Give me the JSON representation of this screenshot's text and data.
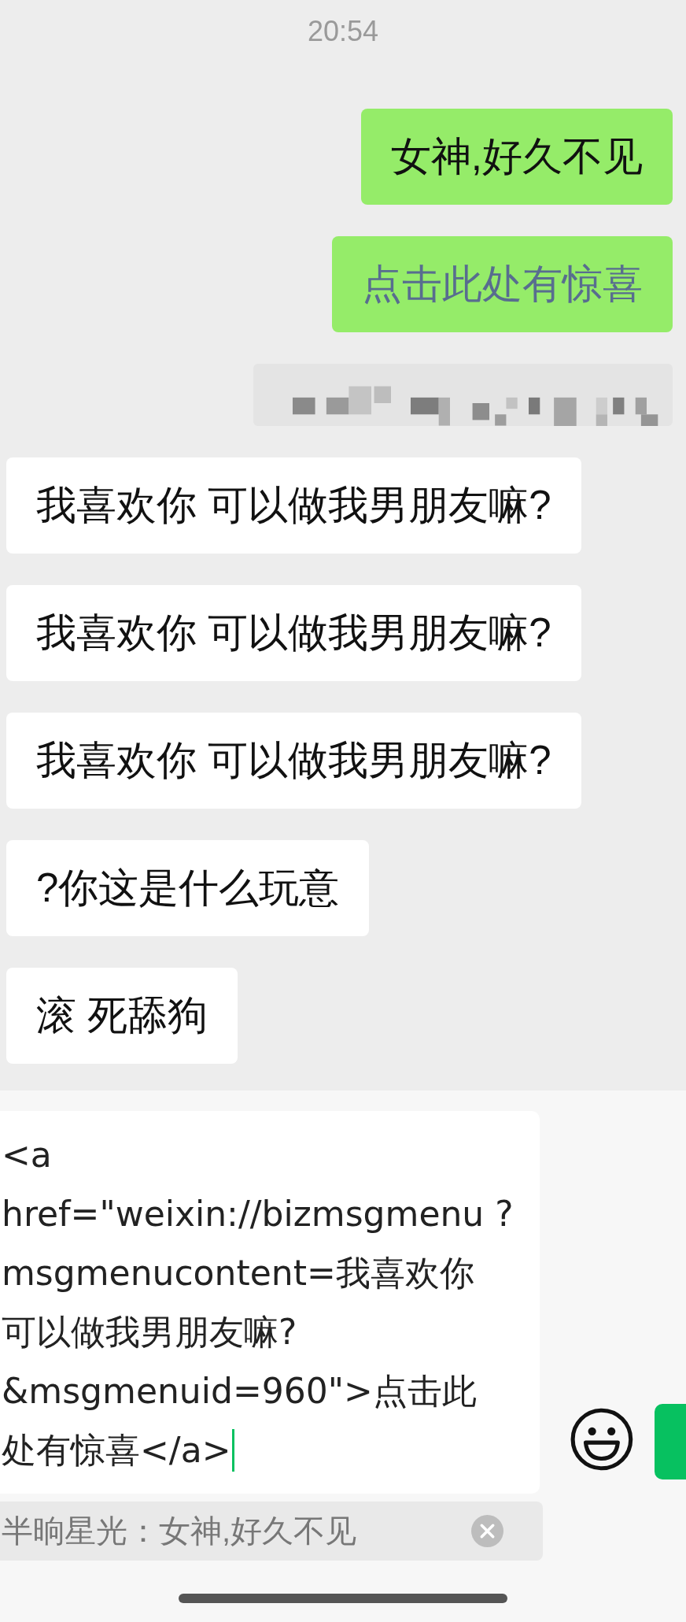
{
  "time": "20:54",
  "messages": [
    {
      "outgoing": true,
      "kind": "text",
      "text": "女神,好久不见"
    },
    {
      "outgoing": true,
      "kind": "link",
      "text": "点击此处有惊喜"
    },
    {
      "outgoing": true,
      "kind": "obscured"
    },
    {
      "outgoing": false,
      "kind": "text",
      "text": "我喜欢你 可以做我男朋友嘛?"
    },
    {
      "outgoing": false,
      "kind": "text",
      "text": "我喜欢你 可以做我男朋友嘛?"
    },
    {
      "outgoing": false,
      "kind": "text",
      "text": "我喜欢你 可以做我男朋友嘛?"
    },
    {
      "outgoing": false,
      "kind": "text",
      "text": "?你这是什么玩意"
    },
    {
      "outgoing": false,
      "kind": "text",
      "text": "滚 死舔狗"
    }
  ],
  "input": {
    "lines": [
      "<a",
      "href=\"weixin://bizmsgmenu ?",
      "msgmenucontent=我喜欢你",
      "可以做我男朋友嘛?",
      "&msgmenuid=960\">点击此",
      "处有惊喜</a>"
    ]
  },
  "quote": {
    "text": "半晌星光：女神,好久不见"
  }
}
